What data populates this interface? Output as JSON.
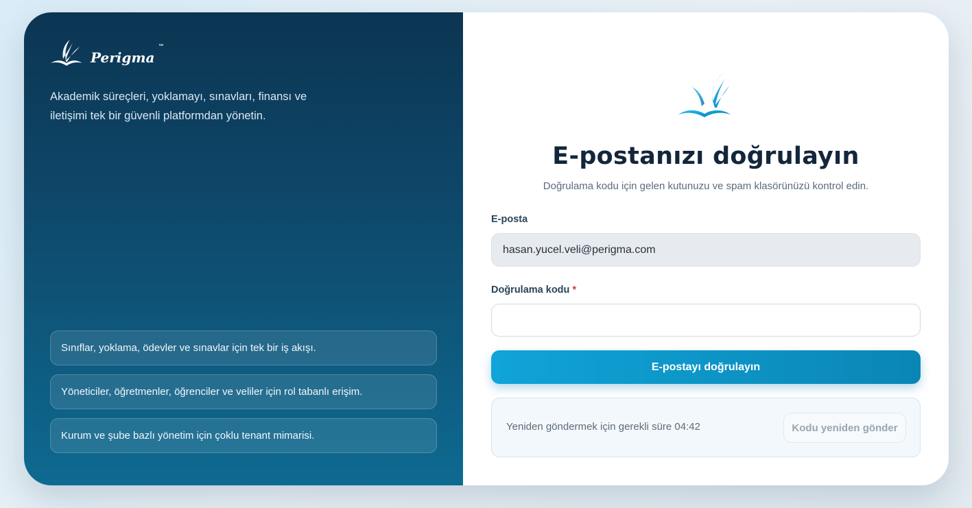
{
  "brand": {
    "name": "Perigma",
    "trademark": "™"
  },
  "left_panel": {
    "tagline": "Akademik süreçleri, yoklamayı, sınavları, finansı ve iletişimi tek bir güvenli platformdan yönetin.",
    "features": [
      "Sınıflar, yoklama, ödevler ve sınavlar için tek bir iş akışı.",
      "Yöneticiler, öğretmenler, öğrenciler ve veliler için rol tabanlı erişim.",
      "Kurum ve şube bazlı yönetim için çoklu tenant mimarisi."
    ]
  },
  "form": {
    "title": "E-postanızı doğrulayın",
    "subtitle": "Doğrulama kodu için gelen kutunuzu ve spam klasörünüzü kontrol edin.",
    "email_label": "E-posta",
    "email_value": "hasan.yucel.veli@perigma.com",
    "code_label": "Doğrulama kodu",
    "required_mark": "*",
    "code_value": "",
    "submit_label": "E-postayı doğrulayın",
    "resend_text": "Yeniden göndermek için gerekli süre 04:42",
    "resend_button": "Kodu yeniden gönder"
  },
  "icons": {
    "logo": "feather-book-icon"
  },
  "colors": {
    "accent": "#10a4d8",
    "panel": "#0c3552",
    "required": "#d23a3a"
  }
}
